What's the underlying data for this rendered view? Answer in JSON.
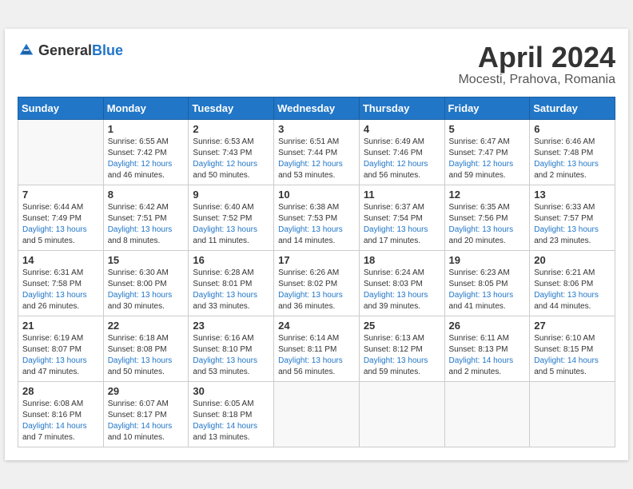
{
  "header": {
    "logo_general": "General",
    "logo_blue": "Blue",
    "month_title": "April 2024",
    "location": "Mocesti, Prahova, Romania"
  },
  "weekdays": [
    "Sunday",
    "Monday",
    "Tuesday",
    "Wednesday",
    "Thursday",
    "Friday",
    "Saturday"
  ],
  "weeks": [
    [
      {
        "day": "",
        "sunrise": "",
        "sunset": "",
        "daylight": ""
      },
      {
        "day": "1",
        "sunrise": "Sunrise: 6:55 AM",
        "sunset": "Sunset: 7:42 PM",
        "daylight": "Daylight: 12 hours and 46 minutes."
      },
      {
        "day": "2",
        "sunrise": "Sunrise: 6:53 AM",
        "sunset": "Sunset: 7:43 PM",
        "daylight": "Daylight: 12 hours and 50 minutes."
      },
      {
        "day": "3",
        "sunrise": "Sunrise: 6:51 AM",
        "sunset": "Sunset: 7:44 PM",
        "daylight": "Daylight: 12 hours and 53 minutes."
      },
      {
        "day": "4",
        "sunrise": "Sunrise: 6:49 AM",
        "sunset": "Sunset: 7:46 PM",
        "daylight": "Daylight: 12 hours and 56 minutes."
      },
      {
        "day": "5",
        "sunrise": "Sunrise: 6:47 AM",
        "sunset": "Sunset: 7:47 PM",
        "daylight": "Daylight: 12 hours and 59 minutes."
      },
      {
        "day": "6",
        "sunrise": "Sunrise: 6:46 AM",
        "sunset": "Sunset: 7:48 PM",
        "daylight": "Daylight: 13 hours and 2 minutes."
      }
    ],
    [
      {
        "day": "7",
        "sunrise": "Sunrise: 6:44 AM",
        "sunset": "Sunset: 7:49 PM",
        "daylight": "Daylight: 13 hours and 5 minutes."
      },
      {
        "day": "8",
        "sunrise": "Sunrise: 6:42 AM",
        "sunset": "Sunset: 7:51 PM",
        "daylight": "Daylight: 13 hours and 8 minutes."
      },
      {
        "day": "9",
        "sunrise": "Sunrise: 6:40 AM",
        "sunset": "Sunset: 7:52 PM",
        "daylight": "Daylight: 13 hours and 11 minutes."
      },
      {
        "day": "10",
        "sunrise": "Sunrise: 6:38 AM",
        "sunset": "Sunset: 7:53 PM",
        "daylight": "Daylight: 13 hours and 14 minutes."
      },
      {
        "day": "11",
        "sunrise": "Sunrise: 6:37 AM",
        "sunset": "Sunset: 7:54 PM",
        "daylight": "Daylight: 13 hours and 17 minutes."
      },
      {
        "day": "12",
        "sunrise": "Sunrise: 6:35 AM",
        "sunset": "Sunset: 7:56 PM",
        "daylight": "Daylight: 13 hours and 20 minutes."
      },
      {
        "day": "13",
        "sunrise": "Sunrise: 6:33 AM",
        "sunset": "Sunset: 7:57 PM",
        "daylight": "Daylight: 13 hours and 23 minutes."
      }
    ],
    [
      {
        "day": "14",
        "sunrise": "Sunrise: 6:31 AM",
        "sunset": "Sunset: 7:58 PM",
        "daylight": "Daylight: 13 hours and 26 minutes."
      },
      {
        "day": "15",
        "sunrise": "Sunrise: 6:30 AM",
        "sunset": "Sunset: 8:00 PM",
        "daylight": "Daylight: 13 hours and 30 minutes."
      },
      {
        "day": "16",
        "sunrise": "Sunrise: 6:28 AM",
        "sunset": "Sunset: 8:01 PM",
        "daylight": "Daylight: 13 hours and 33 minutes."
      },
      {
        "day": "17",
        "sunrise": "Sunrise: 6:26 AM",
        "sunset": "Sunset: 8:02 PM",
        "daylight": "Daylight: 13 hours and 36 minutes."
      },
      {
        "day": "18",
        "sunrise": "Sunrise: 6:24 AM",
        "sunset": "Sunset: 8:03 PM",
        "daylight": "Daylight: 13 hours and 39 minutes."
      },
      {
        "day": "19",
        "sunrise": "Sunrise: 6:23 AM",
        "sunset": "Sunset: 8:05 PM",
        "daylight": "Daylight: 13 hours and 41 minutes."
      },
      {
        "day": "20",
        "sunrise": "Sunrise: 6:21 AM",
        "sunset": "Sunset: 8:06 PM",
        "daylight": "Daylight: 13 hours and 44 minutes."
      }
    ],
    [
      {
        "day": "21",
        "sunrise": "Sunrise: 6:19 AM",
        "sunset": "Sunset: 8:07 PM",
        "daylight": "Daylight: 13 hours and 47 minutes."
      },
      {
        "day": "22",
        "sunrise": "Sunrise: 6:18 AM",
        "sunset": "Sunset: 8:08 PM",
        "daylight": "Daylight: 13 hours and 50 minutes."
      },
      {
        "day": "23",
        "sunrise": "Sunrise: 6:16 AM",
        "sunset": "Sunset: 8:10 PM",
        "daylight": "Daylight: 13 hours and 53 minutes."
      },
      {
        "day": "24",
        "sunrise": "Sunrise: 6:14 AM",
        "sunset": "Sunset: 8:11 PM",
        "daylight": "Daylight: 13 hours and 56 minutes."
      },
      {
        "day": "25",
        "sunrise": "Sunrise: 6:13 AM",
        "sunset": "Sunset: 8:12 PM",
        "daylight": "Daylight: 13 hours and 59 minutes."
      },
      {
        "day": "26",
        "sunrise": "Sunrise: 6:11 AM",
        "sunset": "Sunset: 8:13 PM",
        "daylight": "Daylight: 14 hours and 2 minutes."
      },
      {
        "day": "27",
        "sunrise": "Sunrise: 6:10 AM",
        "sunset": "Sunset: 8:15 PM",
        "daylight": "Daylight: 14 hours and 5 minutes."
      }
    ],
    [
      {
        "day": "28",
        "sunrise": "Sunrise: 6:08 AM",
        "sunset": "Sunset: 8:16 PM",
        "daylight": "Daylight: 14 hours and 7 minutes."
      },
      {
        "day": "29",
        "sunrise": "Sunrise: 6:07 AM",
        "sunset": "Sunset: 8:17 PM",
        "daylight": "Daylight: 14 hours and 10 minutes."
      },
      {
        "day": "30",
        "sunrise": "Sunrise: 6:05 AM",
        "sunset": "Sunset: 8:18 PM",
        "daylight": "Daylight: 14 hours and 13 minutes."
      },
      {
        "day": "",
        "sunrise": "",
        "sunset": "",
        "daylight": ""
      },
      {
        "day": "",
        "sunrise": "",
        "sunset": "",
        "daylight": ""
      },
      {
        "day": "",
        "sunrise": "",
        "sunset": "",
        "daylight": ""
      },
      {
        "day": "",
        "sunrise": "",
        "sunset": "",
        "daylight": ""
      }
    ]
  ]
}
